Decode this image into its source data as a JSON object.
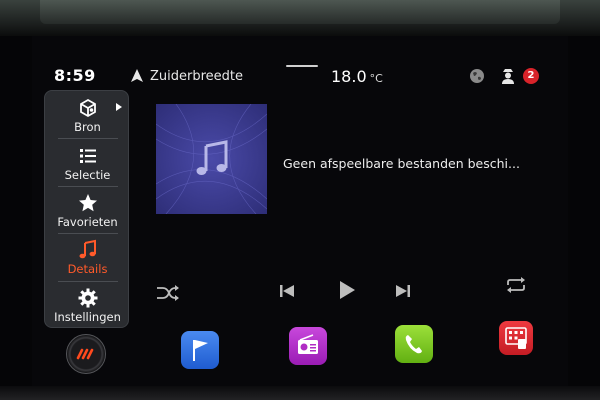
{
  "status_bar": {
    "time": "8:59",
    "street": "Zuiderbreedte",
    "temperature": "18.0",
    "temperature_unit": "°C",
    "notification_count": "2"
  },
  "sidebar": {
    "items": [
      {
        "label": "Bron",
        "icon": "source-icon",
        "active": false
      },
      {
        "label": "Selectie",
        "icon": "list-icon",
        "active": false
      },
      {
        "label": "Favorieten",
        "icon": "star-icon",
        "active": false
      },
      {
        "label": "Details",
        "icon": "music-note-icon",
        "active": true
      },
      {
        "label": "Instellingen",
        "icon": "gear-icon",
        "active": false
      }
    ]
  },
  "player": {
    "message": "Geen afspeelbare bestanden beschi..."
  },
  "dock": {
    "apps": [
      "navigation-flag-icon",
      "radio-icon",
      "phone-icon",
      "apps-grid-icon"
    ]
  },
  "colors": {
    "accent": "#ff5a2a",
    "badge": "#d8232a",
    "album_bg": "#3c3c8c",
    "nav_app": "#2f6fe0",
    "radio_app": "#b02cc4",
    "phone_app": "#7cc81e",
    "grid_app": "#d8262e"
  }
}
